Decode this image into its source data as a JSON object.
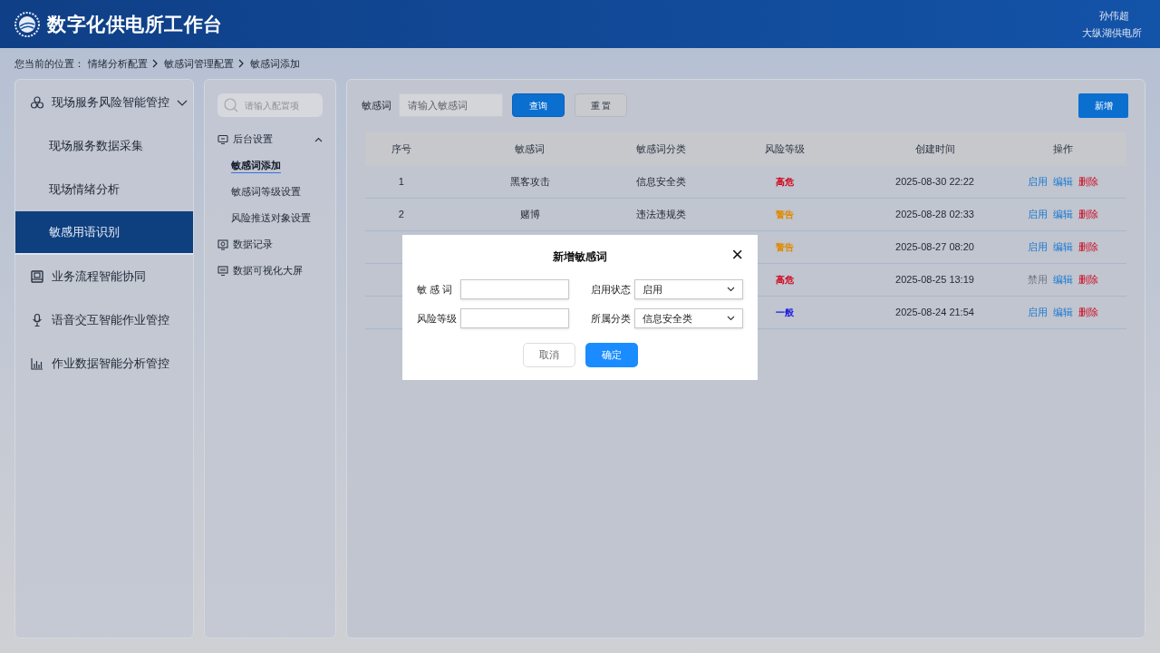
{
  "header": {
    "title": "数字化供电所工作台",
    "user_name": "孙伟超",
    "unit": "大纵湖供电所"
  },
  "breadcrumb": {
    "prefix": "您当前的位置：",
    "items": [
      "情绪分析配置",
      "敏感词管理配置",
      "敏感词添加"
    ]
  },
  "sidebar": {
    "items": [
      {
        "label": "现场服务风险智能管控",
        "selected": false,
        "expanded": true,
        "children": [
          {
            "label": "现场服务数据采集",
            "selected": false
          },
          {
            "label": "现场情绪分析",
            "selected": false
          },
          {
            "label": "敏感用语识别",
            "selected": true
          }
        ]
      },
      {
        "label": "业务流程智能协同",
        "selected": false
      },
      {
        "label": "语音交互智能作业管控",
        "selected": false
      },
      {
        "label": "作业数据智能分析管控",
        "selected": false
      }
    ]
  },
  "config_menu": {
    "search": {
      "placeholder": "请输入配置项"
    },
    "items": [
      {
        "label": "后台设置",
        "selected": false,
        "expanded": true,
        "children": [
          {
            "label": "敏感词添加",
            "selected": true
          },
          {
            "label": "敏感词等级设置",
            "selected": false
          },
          {
            "label": "风险推送对象设置",
            "selected": false
          }
        ]
      },
      {
        "label": "数据记录",
        "selected": false
      },
      {
        "label": "数据可视化大屏",
        "selected": false
      }
    ]
  },
  "filter": {
    "label": "敏感词",
    "placeholder": "请输入敏感词",
    "query_button": "查询",
    "reset_button": "重 置",
    "add_button": "新增"
  },
  "table": {
    "columns": [
      "序号",
      "敏感词",
      "敏感词分类",
      "风险等级",
      "创建时间",
      "操作"
    ],
    "rows": [
      {
        "index": "1",
        "word": "黑客攻击",
        "category": "信息安全类",
        "risk": {
          "label": "高危",
          "color": "#d0021b"
        },
        "created": "2025-08-30 22:22",
        "toggle": {
          "label": "启用",
          "disabled": false
        },
        "edit": "编辑",
        "delete": "删除"
      },
      {
        "index": "2",
        "word": "赌博",
        "category": "违法违规类",
        "risk": {
          "label": "警告",
          "color": "#e08a00"
        },
        "created": "2025-08-28 02:33",
        "toggle": {
          "label": "启用",
          "disabled": false
        },
        "edit": "编辑",
        "delete": "删除"
      },
      {
        "risk": {
          "label": "警告",
          "color": "#e08a00"
        },
        "created": "2025-08-27 08:20",
        "toggle": {
          "label": "启用",
          "disabled": false
        },
        "edit": "编辑",
        "delete": "删除"
      },
      {
        "risk": {
          "label": "高危",
          "color": "#d0021b"
        },
        "created": "2025-08-25 13:19",
        "toggle": {
          "label": "禁用",
          "disabled": true
        },
        "edit": "编辑",
        "delete": "删除"
      },
      {
        "risk": {
          "label": "一般",
          "color": "#1a1adc"
        },
        "created": "2025-08-24 21:54",
        "toggle": {
          "label": "启用",
          "disabled": false
        },
        "edit": "编辑",
        "delete": "删除"
      }
    ]
  },
  "dialog": {
    "title": "新增敏感词",
    "close": "×",
    "fields": [
      {
        "kind": "text",
        "label": "敏 感 词"
      },
      {
        "kind": "select",
        "label": "启用状态",
        "value": "启用"
      },
      {
        "kind": "text",
        "label": "风险等级"
      },
      {
        "kind": "select",
        "label": "所属分类",
        "value": "信息安全类"
      }
    ],
    "cancel_button": "取消",
    "confirm_button": "确定"
  }
}
